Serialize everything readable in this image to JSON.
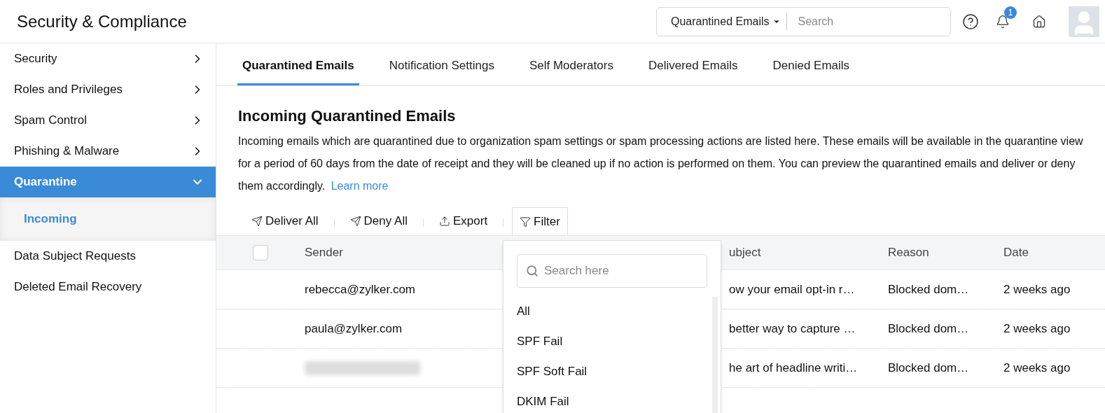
{
  "header": {
    "title": "Security & Compliance",
    "search_scope": "Quarantined Emails",
    "search": {
      "placeholder": "Search"
    },
    "notification_count": "1"
  },
  "sidebar": {
    "items": [
      {
        "label": "Security",
        "expanded": false,
        "selected": false
      },
      {
        "label": "Roles and Privileges",
        "expanded": false,
        "selected": false
      },
      {
        "label": "Spam Control",
        "expanded": false,
        "selected": false
      },
      {
        "label": "Phishing & Malware",
        "expanded": false,
        "selected": false
      },
      {
        "label": "Quarantine",
        "expanded": true,
        "selected": true,
        "children": [
          {
            "label": "Incoming",
            "selected": true
          }
        ]
      },
      {
        "label": "Data Subject Requests",
        "selected": false
      },
      {
        "label": "Deleted Email Recovery",
        "selected": false
      }
    ]
  },
  "tabs": [
    {
      "label": "Quarantined Emails",
      "selected": true
    },
    {
      "label": "Notification Settings",
      "selected": false
    },
    {
      "label": "Self Moderators",
      "selected": false
    },
    {
      "label": "Delivered Emails",
      "selected": false
    },
    {
      "label": "Denied Emails",
      "selected": false
    }
  ],
  "heading": "Incoming Quarantined Emails",
  "description": "Incoming emails which are quarantined due to organization spam settings or spam processing actions are listed here. These emails will be available in the quarantine view for a period of 60 days from the date of receipt and they will be cleaned up if no action is performed on them. You can preview the quarantined emails and deliver or deny them accordingly.",
  "learn_more": "Learn more",
  "toolbar": [
    {
      "kind": "deliver",
      "label": "Deliver All",
      "selected": false
    },
    {
      "kind": "deny",
      "label": "Deny All",
      "selected": false
    },
    {
      "kind": "export",
      "label": "Export",
      "selected": false
    },
    {
      "kind": "filter",
      "label": "Filter",
      "selected": true
    }
  ],
  "table": {
    "select_all_checked": false,
    "columns": [
      "Sender",
      "ubject",
      "Reason",
      "Date"
    ],
    "rows": [
      {
        "sender": "rebecca@zylker.com",
        "subject": "ow your email opt-in r…",
        "reason": "Blocked dom…",
        "date": "2 weeks ago"
      },
      {
        "sender": "paula@zylker.com",
        "subject": "better way to capture …",
        "reason": "Blocked dom…",
        "date": "2 weeks ago"
      },
      {
        "sender_redacted": true,
        "subject": "he art of headline writi…",
        "reason": "Blocked dom…",
        "date": "2 weeks ago"
      }
    ]
  },
  "filter_menu": {
    "search": {
      "placeholder": "Search here"
    },
    "options": [
      "All",
      "SPF Fail",
      "SPF Soft Fail",
      "DKIM Fail"
    ]
  }
}
